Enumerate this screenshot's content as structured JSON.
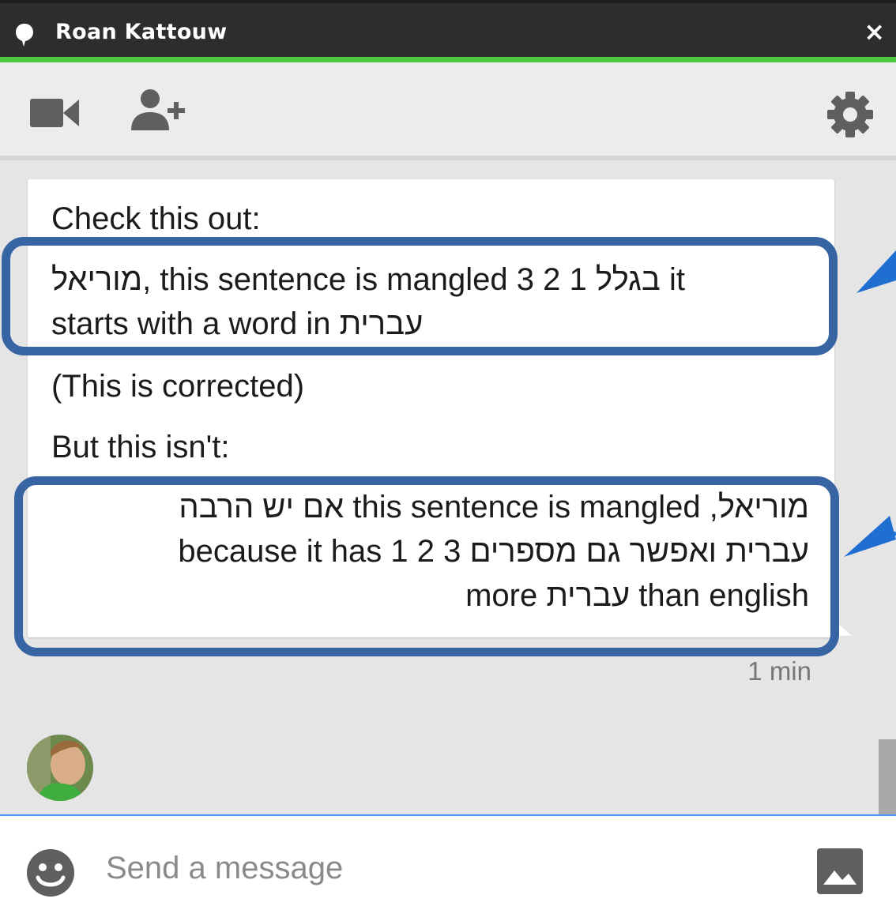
{
  "window": {
    "title": "Roan Kattouw",
    "close_label": "×"
  },
  "toolbar": {
    "icons": [
      "video-camera-icon",
      "add-person-icon",
      "gear-icon"
    ]
  },
  "message": {
    "lines": [
      "Check this out:",
      "מוריאל, this sentence is mangled 3 2 1 בגלל it",
      "starts with a word in עברית",
      "(This is corrected)",
      "But this isn't:",
      "מוריאל, this sentence is mangled אם יש הרבה",
      "עברית ואפשר גם מספרים 3 2 1 because it has",
      "than english עברית more"
    ],
    "timestamp": "1 min"
  },
  "composer": {
    "placeholder": "Send a message"
  },
  "colors": {
    "accent": "#4ec93e",
    "highlight_box": "#3765a3",
    "arrow": "#1f6fd1",
    "input_focus": "#4d90fe"
  }
}
